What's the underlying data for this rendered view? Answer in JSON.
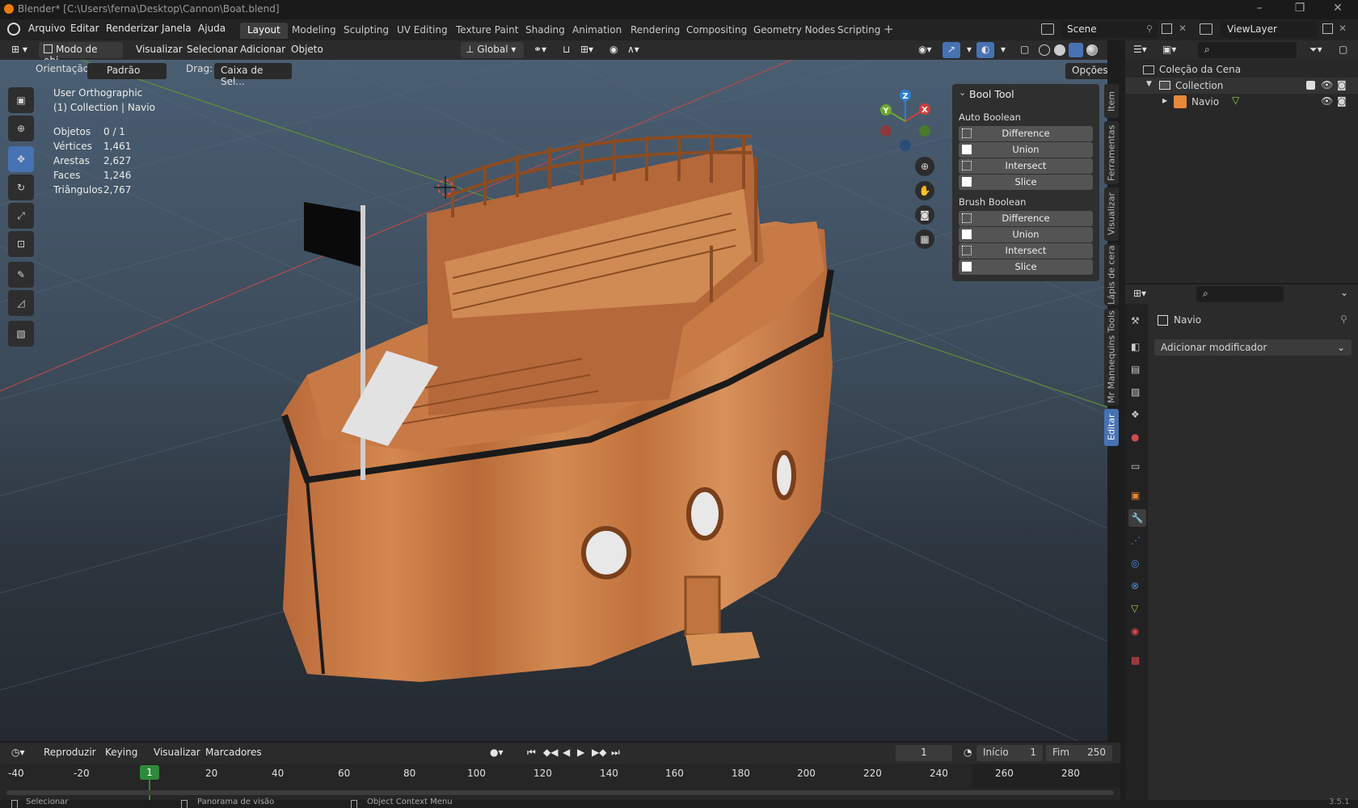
{
  "window": {
    "title": "Blender* [C:\\Users\\ferna\\Desktop\\Cannon\\Boat.blend]"
  },
  "menu": [
    "Arquivo",
    "Editar",
    "Renderizar",
    "Janela",
    "Ajuda"
  ],
  "workspaces": [
    "Layout",
    "Modeling",
    "Sculpting",
    "UV Editing",
    "Texture Paint",
    "Shading",
    "Animation",
    "Rendering",
    "Compositing",
    "Geometry Nodes",
    "Scripting"
  ],
  "active_workspace": "Layout",
  "scene": "Scene",
  "view_layer": "ViewLayer",
  "header": {
    "mode": "Modo de obj...",
    "menus": [
      "Visualizar",
      "Selecionar",
      "Adicionar",
      "Objeto"
    ],
    "transform_orientation": "Global"
  },
  "tool_settings": {
    "orientation_label": "Orientação:",
    "orientation_value": "Padrão",
    "drag_label": "Drag:",
    "drag_value": "Caixa de Sel...",
    "options": "Opções"
  },
  "viewport": {
    "view_name": "User Orthographic",
    "collection_line": "(1) Collection | Navio",
    "stats": [
      {
        "label": "Objetos",
        "value": "0 / 1"
      },
      {
        "label": "Vértices",
        "value": "1,461"
      },
      {
        "label": "Arestas",
        "value": "2,627"
      },
      {
        "label": "Faces",
        "value": "1,246"
      },
      {
        "label": "Triângulos",
        "value": "2,767"
      }
    ],
    "gizmo_axes": {
      "x": "X",
      "y": "Y",
      "z": "Z"
    }
  },
  "bool_tool": {
    "title": "Bool Tool",
    "auto_label": "Auto Boolean",
    "auto_buttons": [
      "Difference",
      "Union",
      "Intersect",
      "Slice"
    ],
    "brush_label": "Brush Boolean",
    "brush_buttons": [
      "Difference",
      "Union",
      "Intersect",
      "Slice"
    ]
  },
  "sidebar_tabs": [
    "Item",
    "Ferramentas",
    "Visualizar",
    "Lápis de cera",
    "Mr Mannequins Tools",
    "Editar"
  ],
  "active_sidebar_tab": "Editar",
  "outliner": {
    "root": "Coleção da Cena",
    "collection": "Collection",
    "object": "Navio"
  },
  "properties": {
    "object_name": "Navio",
    "add_modifier": "Adicionar modificador"
  },
  "timeline": {
    "menus": [
      "Reproduzir",
      "Keying",
      "Visualizar",
      "Marcadores"
    ],
    "current_frame": "1",
    "start_label": "Início",
    "start_value": "1",
    "end_label": "Fim",
    "end_value": "250",
    "ticks": [
      "-40",
      "-20",
      "1",
      "20",
      "40",
      "60",
      "80",
      "100",
      "120",
      "140",
      "160",
      "180",
      "200",
      "220",
      "240",
      "260",
      "280"
    ]
  },
  "statusbar": [
    "Selecionar",
    "Panorama de visão",
    "Object Context Menu",
    "3.5.1"
  ],
  "colors": {
    "accent": "#4772b3",
    "wood": "#c97a45",
    "frame_marker": "#2f8a3a"
  }
}
